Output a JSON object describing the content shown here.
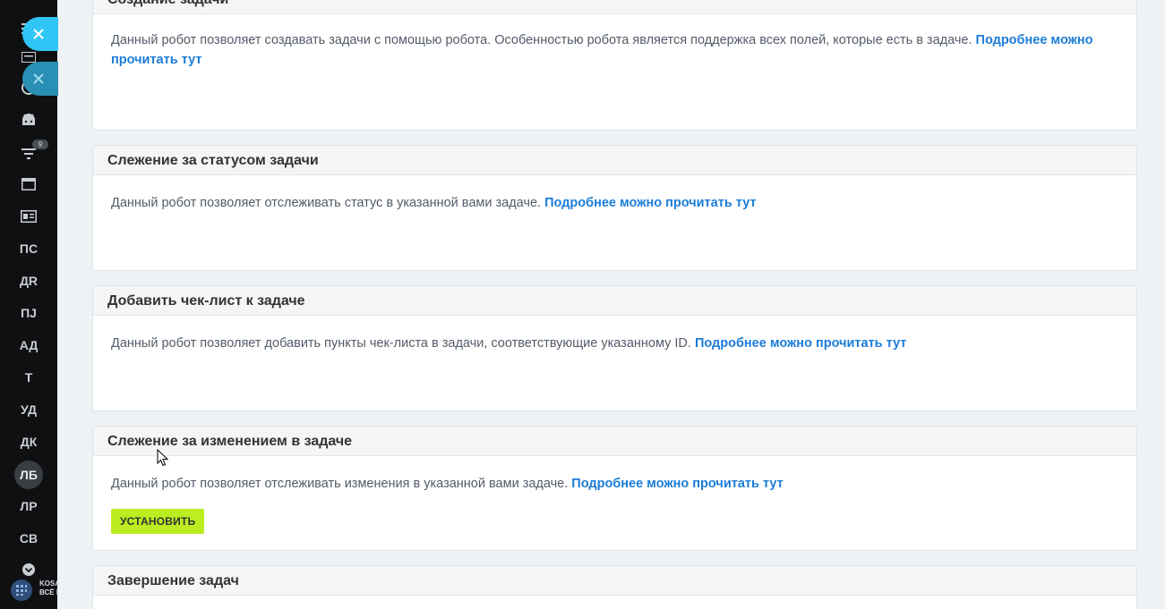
{
  "sidebar": {
    "items": [
      {
        "label": "ПС"
      },
      {
        "label": "ДR"
      },
      {
        "label": "ПЈ"
      },
      {
        "label": "АД"
      },
      {
        "label": "Т"
      },
      {
        "label": "УД"
      },
      {
        "label": "ДК"
      },
      {
        "label": "ЛБ"
      },
      {
        "label": "ЛР"
      },
      {
        "label": "СВ"
      }
    ],
    "filter_badge": "9",
    "footer_text_line1": "KOSA",
    "footer_text_line2": "ВСЁ I"
  },
  "cards": [
    {
      "title": "Создание задачи",
      "text": "Данный робот позволяет создавать задачи с помощью робота. Особенностью робота является поддержка всех полей, которые есть в задаче. ",
      "link": "Подробнее можно прочитать тут"
    },
    {
      "title": "Слежение за статусом задачи",
      "text": "Данный робот позволяет отслеживать статус в указанной вами задаче. ",
      "link": "Подробнее можно прочитать тут"
    },
    {
      "title": "Добавить чек-лист к задаче",
      "text": "Данный робот позволяет добавить пункты чек-листа в задачи, соответствующие указанному ID. ",
      "link": "Подробнее можно прочитать тут"
    },
    {
      "title": "Слежение за изменением в задаче",
      "text": "Данный робот позволяет отслеживать изменения в указанной вами задаче. ",
      "link": "Подробнее можно прочитать тут",
      "button": "УСТАНОВИТЬ"
    },
    {
      "title": "Завершение задач"
    }
  ],
  "colors": {
    "accent_link": "#1c7dd8",
    "install_button": "#bbed21",
    "close_button": "#2fc6f6",
    "sidebar_bg": "#0f1012"
  },
  "icons": [
    "menu-icon",
    "keyboard-icon",
    "clock-icon",
    "android-icon",
    "filter-icon",
    "browser-icon",
    "contact-card-icon",
    "chevron-down-icon",
    "close-icon"
  ]
}
